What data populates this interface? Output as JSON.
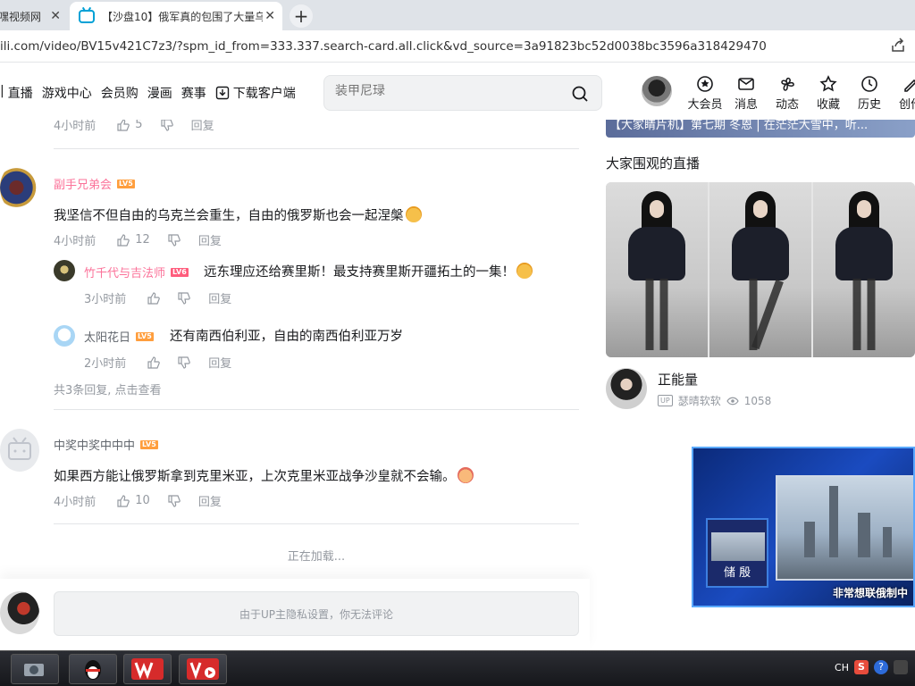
{
  "browser": {
    "tabs": [
      {
        "label": "嘿视频网"
      },
      {
        "label": "【沙盘10】俄军真的包围了大量乌"
      }
    ],
    "url": "ili.com/video/BV15v421C7z3/?spm_id_from=333.337.search-card.all.click&vd_source=3a91823bc52d0038bc3596a318429470"
  },
  "header": {
    "nav": [
      "直播",
      "游戏中心",
      "会员购",
      "漫画",
      "赛事",
      "下载客户端"
    ],
    "search_placeholder": "装甲尼琭",
    "icons": [
      {
        "label": "大会员",
        "icon": "vip-icon"
      },
      {
        "label": "消息",
        "icon": "message-icon"
      },
      {
        "label": "动态",
        "icon": "dynamic-icon"
      },
      {
        "label": "收藏",
        "icon": "star-icon"
      },
      {
        "label": "历史",
        "icon": "history-icon"
      },
      {
        "label": "创作",
        "icon": "create-icon"
      }
    ]
  },
  "comments": {
    "top_meta": {
      "time": "4小时前",
      "likes": "5",
      "reply": "回复"
    },
    "items": [
      {
        "user": "副手兄弟会",
        "level": "LV5",
        "text": "我坚信不但自由的乌克兰会重生，自由的俄罗斯也会一起涅槃",
        "time": "4小时前",
        "likes": "12",
        "reply": "回复",
        "replies": [
          {
            "user": "竹千代与吉法师",
            "level": "LV6",
            "text": "远东理应还给赛里斯！最支持赛里斯开疆拓土的一集！",
            "time": "3小时前",
            "reply": "回复"
          },
          {
            "user": "太阳花日",
            "level": "LV5",
            "text": "还有南西伯利亚，自由的南西伯利亚万岁",
            "time": "2小时前",
            "reply": "回复"
          }
        ],
        "more_replies": "共3条回复, 点击查看"
      },
      {
        "user": "中奖中奖中中中",
        "level": "LV5",
        "text": "如果西方能让俄罗斯拿到克里米亚，上次克里米亚战争沙皇就不会输。",
        "time": "4小时前",
        "likes": "10",
        "reply": "回复"
      }
    ],
    "loading": "正在加载...",
    "input_placeholder": "由于UP主隐私设置，你无法评论"
  },
  "sidebar": {
    "banner_text": "【大家睛片机】第七期 冬恩 | 在茫茫大雪中，听...",
    "section_title": "大家围观的直播",
    "streamer_name": "正能量",
    "streamer_user": "瑟晴软软",
    "viewers": "1058",
    "ad": {
      "name": "储 殷",
      "caption": "非常想联俄制中"
    }
  },
  "taskbar": {
    "lang": "CH"
  }
}
